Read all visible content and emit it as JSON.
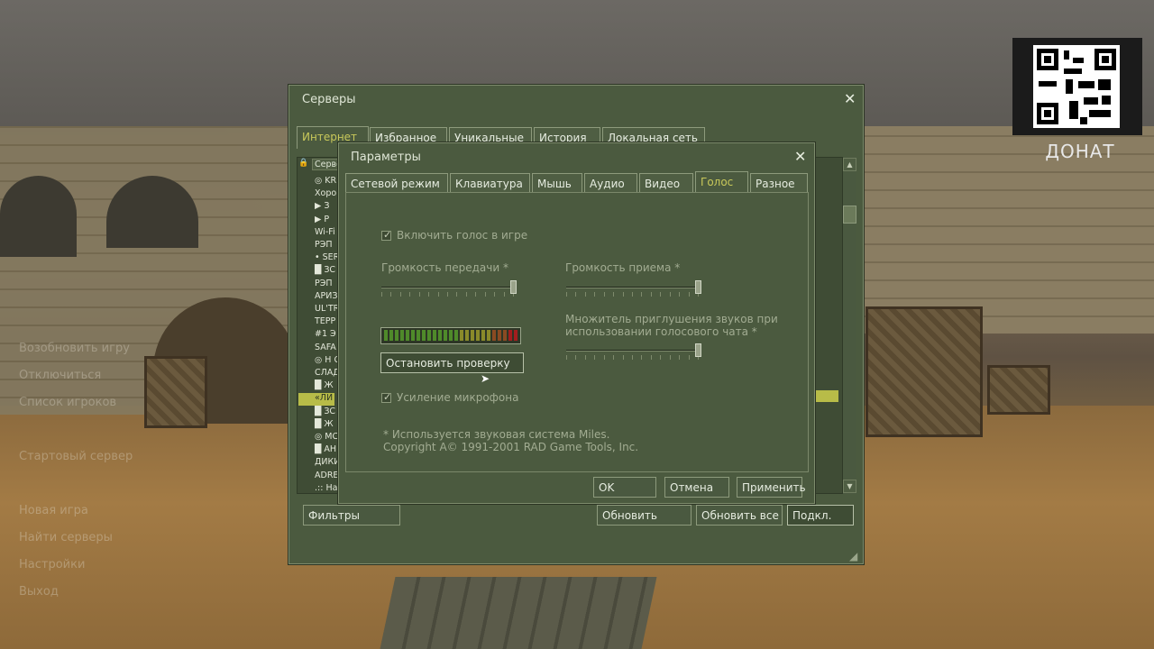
{
  "main_menu": [
    "Возобновить игру",
    "Отключиться",
    "Список игроков",
    "Стартовый сервер",
    "Новая игра",
    "Найти серверы",
    "Настройки",
    "Выход"
  ],
  "donat": {
    "label": "ДОНАТ"
  },
  "servers_window": {
    "title": "Серверы",
    "tabs": [
      "Интернет",
      "Избранное",
      "Уникальные",
      "История",
      "Локальная сеть"
    ],
    "list_header": "Серве",
    "rows": [
      "◎ KR",
      "Хоро",
      "▶ З",
      "▶ Р",
      "Wi-Fi",
      "РЭП",
      "• SER",
      "█ ЗС",
      "РЭП",
      "АРИЗ",
      "UL'TR",
      "ТЕРР",
      "#1 Э",
      "SAFA",
      "◎ Н С",
      "СЛАД",
      "█ Ж",
      "«ЛИ",
      "█ ЗС",
      "█ Ж",
      "◎ МС",
      "█ АН",
      "ДИКИ",
      "ADRE",
      ".:: На"
    ],
    "buttons": {
      "filters": "Фильтры",
      "refresh": "Обновить",
      "refresh_all": "Обновить все",
      "connect": "Подкл."
    }
  },
  "options_dialog": {
    "title": "Параметры",
    "tabs": [
      "Сетевой режим",
      "Клавиатура",
      "Мышь",
      "Аудио",
      "Видео",
      "Голос",
      "Разное"
    ],
    "active_tab": "Голос",
    "enable_voice": "Включить голос в игре",
    "transmit_volume": "Громкость передачи *",
    "receive_volume": "Громкость приема *",
    "attenuation_label_1": "Множитель приглушения звуков при",
    "attenuation_label_2": "использовании голосового чата *",
    "stop_test": "Остановить проверку",
    "mic_boost": "Усиление микрофона",
    "footnote_1": "* Используется звуковая система Miles.",
    "footnote_2": "Copyright A© 1991-2001 RAD Game Tools, Inc.",
    "buttons": {
      "ok": "OK",
      "cancel": "Отмена",
      "apply": "Применить"
    },
    "transmit_level": 1.0,
    "receive_level": 1.0,
    "attenuation_level": 1.0
  },
  "colors": {
    "accent_tab": "#c8c85a",
    "panel": "#4b5a3f",
    "highlight_row": "#b8bc48"
  }
}
